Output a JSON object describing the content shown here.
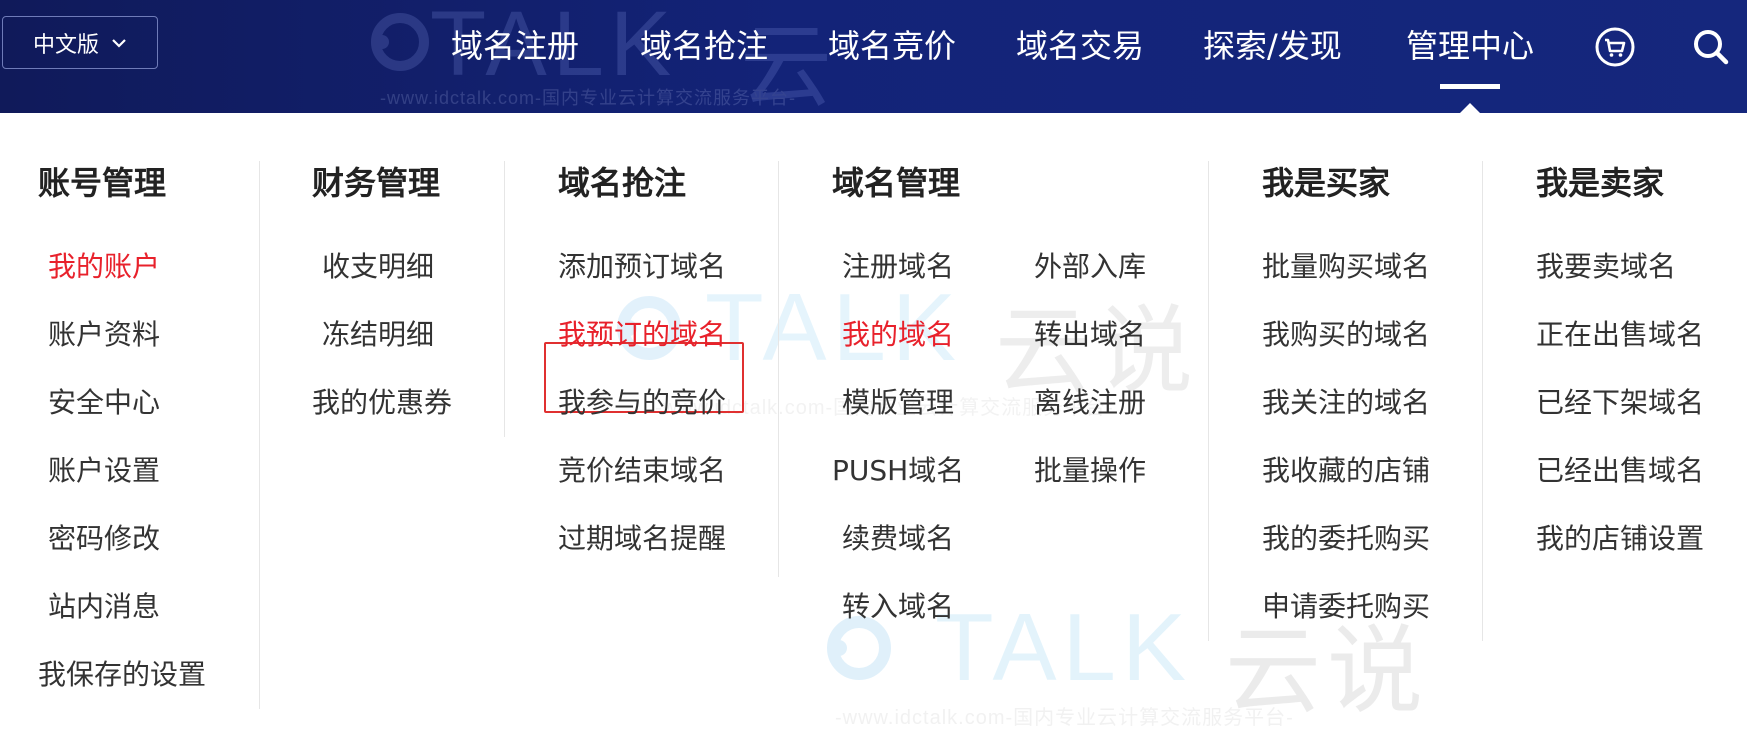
{
  "header": {
    "language_select": {
      "value": "中文版",
      "icon": "chevron-down-icon"
    },
    "nav": [
      {
        "label": "域名注册"
      },
      {
        "label": "域名抢注"
      },
      {
        "label": "域名竞价"
      },
      {
        "label": "域名交易"
      },
      {
        "label": "探索/发现"
      },
      {
        "label": "管理中心",
        "active": true
      }
    ],
    "icons": [
      "cart-icon",
      "search-icon"
    ],
    "background_color": "#132378",
    "text_color": "#ffffff"
  },
  "watermark": {
    "logo_text": "TALK",
    "logo_cn": "云说",
    "url_text": "-www.idctalk.com-国内专业云计算交流服务平台-"
  },
  "menu": {
    "accent_color": "#e8212b",
    "columns": [
      {
        "heading": "账号管理",
        "items": [
          "我的账户",
          "账户资料",
          "安全中心",
          "账户设置",
          "密码修改",
          "站内消息",
          "我保存的设置"
        ],
        "active_index": 0
      },
      {
        "heading": "财务管理",
        "items": [
          "收支明细",
          "冻结明细",
          "我的优惠券"
        ]
      },
      {
        "heading": "域名抢注",
        "items": [
          "添加预订域名",
          "我预订的域名",
          "我参与的竞价",
          "竞价结束域名",
          "过期域名提醒"
        ],
        "active_index": 1,
        "boxed_index": 0
      },
      {
        "heading": "域名管理",
        "items_left": [
          "注册域名",
          "我的域名",
          "模版管理",
          "PUSH域名",
          "续费域名",
          "转入域名"
        ],
        "items_right": [
          "外部入库",
          "转出域名",
          "离线注册",
          "批量操作"
        ],
        "active_left_index": 1
      },
      {
        "heading": "我是买家",
        "items": [
          "批量购买域名",
          "我购买的域名",
          "我关注的域名",
          "我收藏的店铺",
          "我的委托购买",
          "申请委托购买"
        ]
      },
      {
        "heading": "我是卖家",
        "items": [
          "我要卖域名",
          "正在出售域名",
          "已经下架域名",
          "已经出售域名",
          "我的店铺设置"
        ]
      }
    ]
  }
}
